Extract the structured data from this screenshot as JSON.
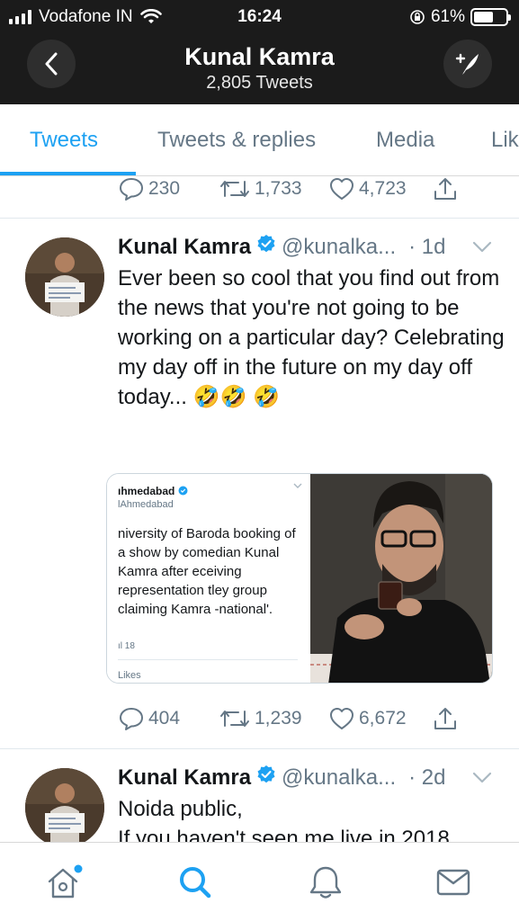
{
  "status_bar": {
    "carrier": "Vodafone IN",
    "time": "16:24",
    "battery": "61%",
    "battery_level": 0.61
  },
  "header": {
    "title": "Kunal Kamra",
    "subtitle": "2,805 Tweets"
  },
  "tabs": [
    {
      "label": "Tweets",
      "active": true
    },
    {
      "label": "Tweets & replies",
      "active": false
    },
    {
      "label": "Media",
      "active": false
    },
    {
      "label": "Lik",
      "active": false
    }
  ],
  "tweets": [
    {
      "actions": {
        "replies": "230",
        "retweets": "1,733",
        "likes": "4,723"
      }
    },
    {
      "name": "Kunal Kamra",
      "handle": "@kunalka...",
      "time": "· 1d",
      "text": "Ever been so cool that you find out from the news that you're not going to be working on a particular day? Celebrating my day off in the future on my day off today... 🤣🤣 🤣",
      "media": {
        "name": "ıhmedabad",
        "handle": "lAhmedabad",
        "text": "niversity of Baroda booking of a show by comedian Kunal Kamra after eceiving representation tley group claiming Kamra -national'.",
        "date": "ıl 18",
        "likes": "Likes"
      },
      "actions": {
        "replies": "404",
        "retweets": "1,239",
        "likes": "6,672"
      }
    },
    {
      "name": "Kunal Kamra",
      "handle": "@kunalka...",
      "time": "· 2d",
      "text": "Noida public,\nIf you haven't seen me live in 2018"
    }
  ],
  "colors": {
    "accent": "#1da1f2",
    "header_bg": "#1b1b1b",
    "muted": "#657786"
  },
  "icons": {
    "tab_bar": [
      "home-icon",
      "search-icon",
      "notifications-icon",
      "messages-icon"
    ]
  }
}
